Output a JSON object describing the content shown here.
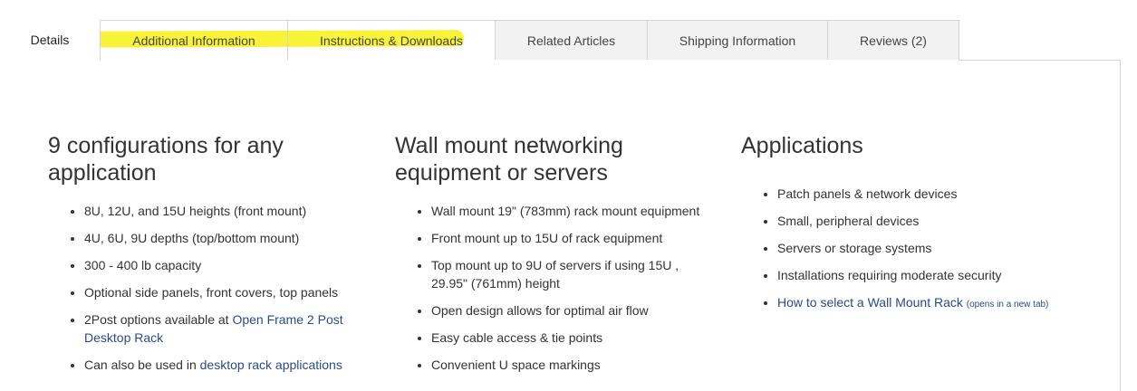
{
  "tabs": [
    {
      "label": "Details"
    },
    {
      "label": "Additional Information"
    },
    {
      "label": "Instructions & Downloads"
    },
    {
      "label": "Related Articles"
    },
    {
      "label": "Shipping Information"
    },
    {
      "label": "Reviews (2)"
    }
  ],
  "highlight_color": "#f7f227",
  "columns": [
    {
      "heading": "9 configurations for any application",
      "items": {
        "i0": "8U, 12U, and 15U heights (front mount)",
        "i1": "4U, 6U, 9U depths (top/bottom mount)",
        "i2": "300 - 400 lb capacity",
        "i3": "Optional side panels, front covers, top panels",
        "i4_prefix": "2Post options available at ",
        "i4_link": "Open Frame 2 Post Desktop Rack",
        "i5_prefix": "Can also be used in ",
        "i5_link": "desktop rack applications"
      }
    },
    {
      "heading": "Wall mount networking equipment or servers",
      "items": [
        "Wall mount 19\" (783mm) rack mount equipment",
        "Front mount up to 15U of rack equipment",
        "Top mount up to 9U of servers if using 15U , 29.95\" (761mm) height",
        "Open design allows for optimal air flow",
        "Easy cable access & tie points",
        "Convenient U space markings"
      ]
    },
    {
      "heading": "Applications",
      "items": [
        "Patch panels & network devices",
        "Small, peripheral devices",
        "Servers or storage systems",
        "Installations requiring moderate security"
      ],
      "link": "How to select a Wall Mount Rack",
      "link_note": "(opens in a new tab)"
    }
  ]
}
